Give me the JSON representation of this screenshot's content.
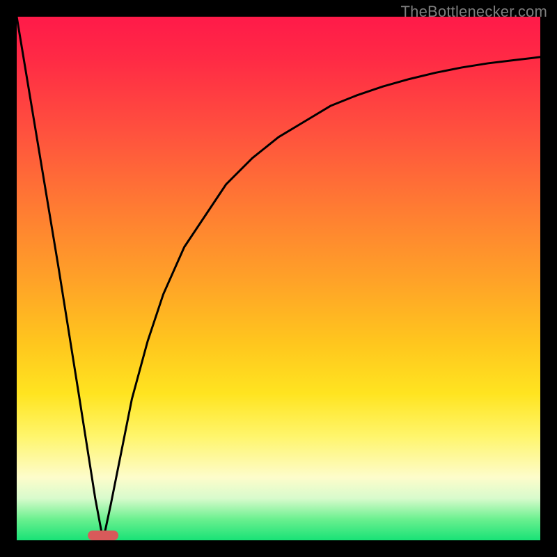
{
  "watermark": "TheBottlenecker.com",
  "bottleneck_marker": {
    "x_norm": 0.165,
    "color": "#d85a5a"
  },
  "chart_data": {
    "type": "line",
    "title": "",
    "xlabel": "",
    "ylabel": "",
    "xlim": [
      0,
      1
    ],
    "ylim": [
      0,
      100
    ],
    "series": [
      {
        "name": "bottleneck-curve",
        "x": [
          0.0,
          0.04,
          0.08,
          0.12,
          0.15,
          0.165,
          0.18,
          0.2,
          0.22,
          0.25,
          0.28,
          0.32,
          0.36,
          0.4,
          0.45,
          0.5,
          0.55,
          0.6,
          0.65,
          0.7,
          0.75,
          0.8,
          0.85,
          0.9,
          0.95,
          1.0
        ],
        "y": [
          100,
          76,
          52,
          27,
          8,
          0,
          7,
          17,
          27,
          38,
          47,
          56,
          62,
          68,
          73,
          77,
          80,
          83,
          85,
          86.7,
          88.1,
          89.3,
          90.3,
          91.1,
          91.7,
          92.3
        ]
      }
    ],
    "annotations": []
  }
}
